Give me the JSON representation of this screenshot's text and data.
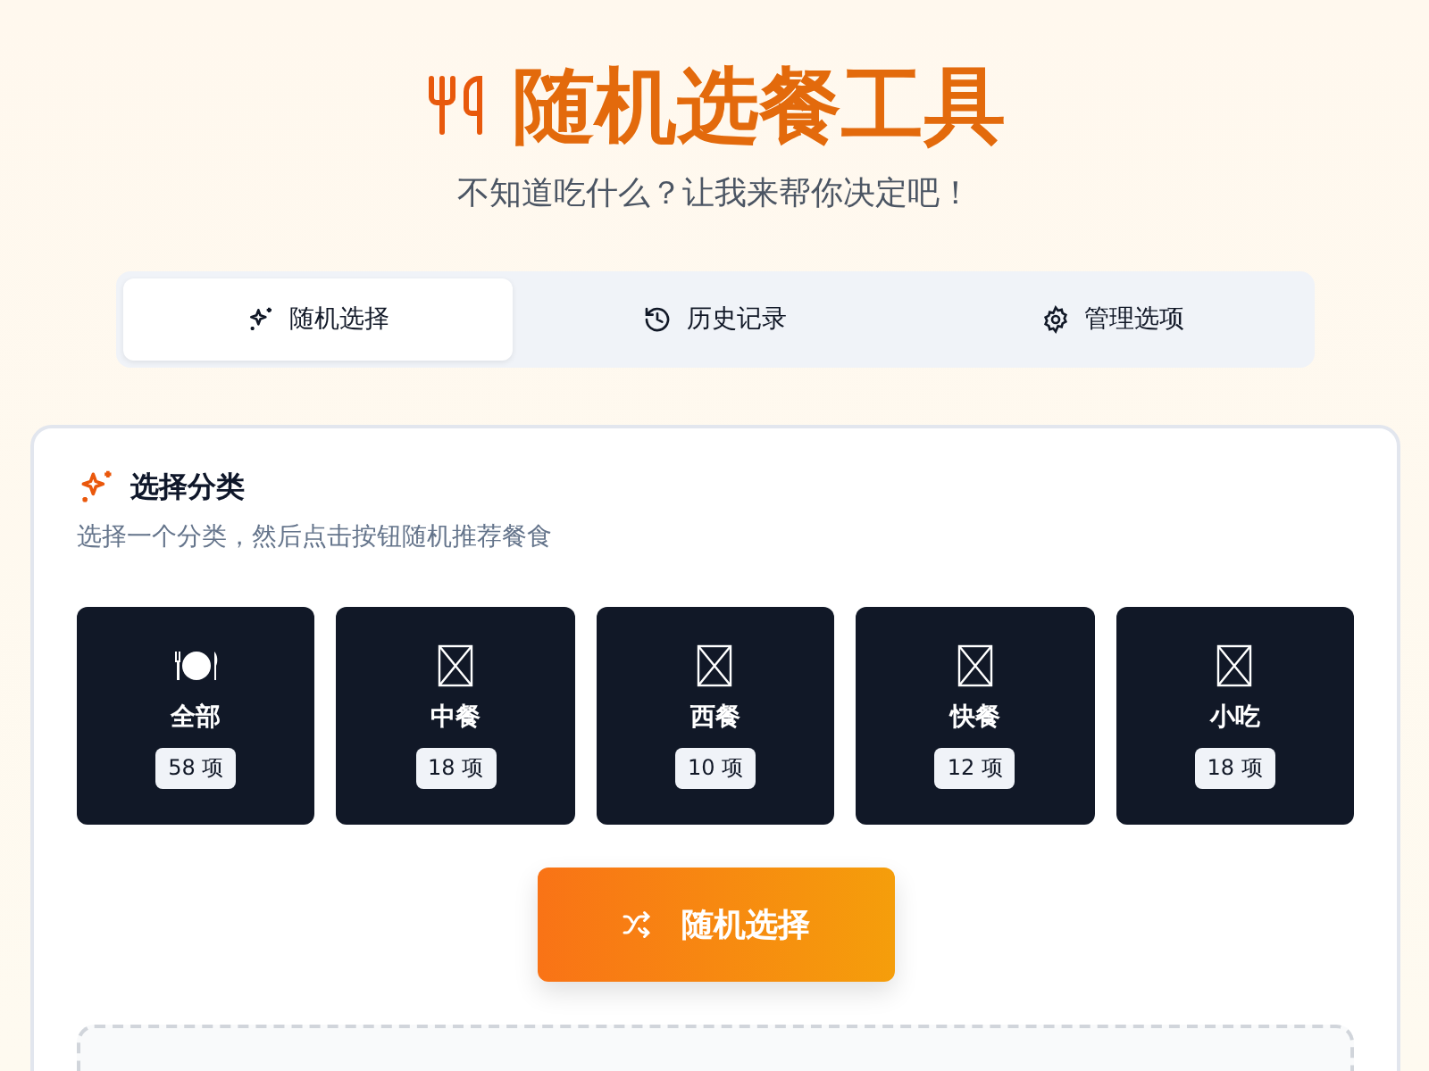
{
  "header": {
    "title": "随机选餐工具",
    "subtitle": "不知道吃什么？让我来帮你决定吧！"
  },
  "tabs": [
    {
      "label": "随机选择",
      "kind": "pick",
      "selected": true
    },
    {
      "label": "历史记录",
      "kind": "history",
      "selected": false
    },
    {
      "label": "管理选项",
      "kind": "manage",
      "selected": false
    }
  ],
  "panel": {
    "title": "选择分类",
    "description": "选择一个分类，然后点击按钮随机推荐餐食",
    "categories": [
      {
        "name": "全部",
        "kind": "plate",
        "count": "58 项"
      },
      {
        "name": "中餐",
        "kind": "missing",
        "count": "18 项"
      },
      {
        "name": "西餐",
        "kind": "missing",
        "count": "10 项"
      },
      {
        "name": "快餐",
        "kind": "missing",
        "count": "12 项"
      },
      {
        "name": "小吃",
        "kind": "missing",
        "count": "18 项"
      }
    ],
    "button": "随机选择"
  }
}
